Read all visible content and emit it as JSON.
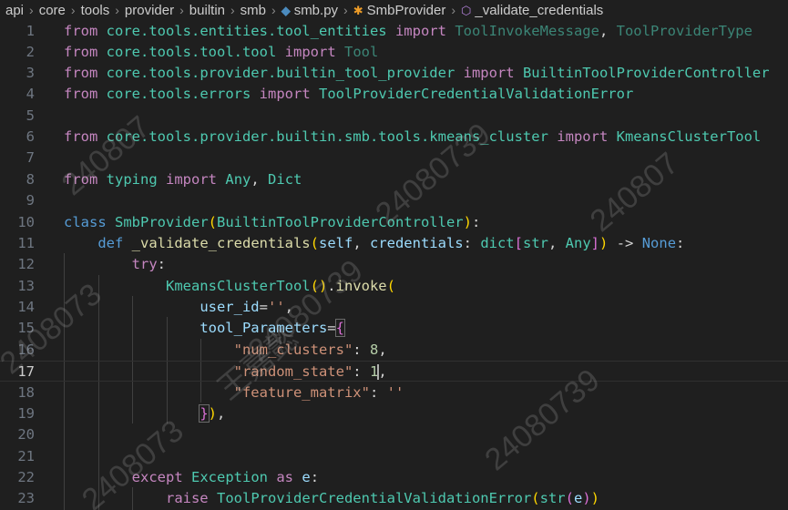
{
  "breadcrumb": {
    "items": [
      "api",
      "core",
      "tools",
      "provider",
      "builtin",
      "smb",
      "smb.py",
      "SmbProvider",
      "_validate_credentials"
    ]
  },
  "editor": {
    "current_line": 17,
    "lines": [
      {
        "n": "1"
      },
      {
        "n": "2"
      },
      {
        "n": "3"
      },
      {
        "n": "4"
      },
      {
        "n": "5"
      },
      {
        "n": "6"
      },
      {
        "n": "7"
      },
      {
        "n": "8"
      },
      {
        "n": "9"
      },
      {
        "n": "10"
      },
      {
        "n": "11"
      },
      {
        "n": "12"
      },
      {
        "n": "13"
      },
      {
        "n": "14"
      },
      {
        "n": "15"
      },
      {
        "n": "16"
      },
      {
        "n": "17"
      },
      {
        "n": "18"
      },
      {
        "n": "19"
      },
      {
        "n": "20"
      },
      {
        "n": "21"
      },
      {
        "n": "22"
      },
      {
        "n": "23"
      }
    ],
    "tokens": {
      "from": "from",
      "import": "import",
      "class": "class",
      "def": "def",
      "try": "try",
      "except": "except",
      "as": "as",
      "raise": "raise",
      "l1_mod": "core.tools.entities.tool_entities",
      "l1_a": "ToolInvokeMessage",
      "l1_b": "ToolProviderType",
      "l2_mod": "core.tools.tool.tool",
      "l2_a": "Tool",
      "l3_mod": "core.tools.provider.builtin_tool_provider",
      "l3_a": "BuiltinToolProviderController",
      "l4_mod": "core.tools.errors",
      "l4_a": "ToolProviderCredentialValidationError",
      "l6_mod": "core.tools.provider.builtin.smb.tools.kmeans_cluster",
      "l6_a": "KmeansClusterTool",
      "l8_mod": "typing",
      "l8_a": "Any",
      "l8_b": "Dict",
      "l10_cls": "SmbProvider",
      "l10_base": "BuiltinToolProviderController",
      "l11_fn": "_validate_credentials",
      "l11_self": "self",
      "l11_param": "credentials",
      "l11_dict": "dict",
      "l11_str": "str",
      "l11_any": "Any",
      "l11_arrow": "->",
      "l11_none": "None",
      "l13_cls": "KmeansClusterTool",
      "l13_fn": "invoke",
      "l14_param": "user_id",
      "l14_val": "''",
      "l15_param": "tool_Parameters",
      "l16_key": "\"num_clusters\"",
      "l16_val": "8",
      "l17_key": "\"random_state\"",
      "l17_val": "1",
      "l18_key": "\"feature_matrix\"",
      "l18_val": "''",
      "l22_exc": "Exception",
      "l22_var": "e",
      "l23_err": "ToolProviderCredentialValidationError",
      "l23_str": "str",
      "l23_var": "e"
    }
  },
  "watermark": {
    "text_a": "240807",
    "text_b": "2408073",
    "text_c": "24080739",
    "text_d": "王嘉懿"
  }
}
